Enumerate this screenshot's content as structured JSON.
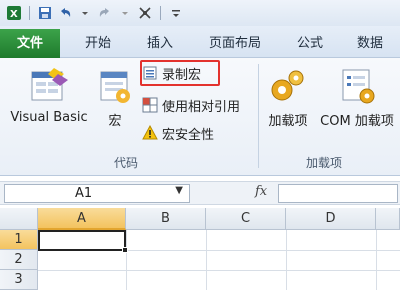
{
  "tabs": {
    "file": "文件",
    "home": "开始",
    "insert": "插入",
    "page_layout": "页面布局",
    "formulas": "公式",
    "data": "数据"
  },
  "ribbon": {
    "visual_basic": "Visual Basic",
    "macros": "宏",
    "record_macro": "录制宏",
    "relative_refs": "使用相对引用",
    "macro_security": "宏安全性",
    "code_group": "代码",
    "addins": "加载项",
    "com_addins": "COM 加载项",
    "addins_group": "加载项"
  },
  "formula_bar": {
    "name_box": "A1",
    "fx": "fx"
  },
  "grid": {
    "columns": [
      "A",
      "B",
      "C",
      "D"
    ],
    "rows": [
      "1",
      "2",
      "3"
    ]
  },
  "colors": {
    "file_tab": "#1f7a2c",
    "highlight": "#e3322e",
    "selected_header": "#f3c35f"
  }
}
